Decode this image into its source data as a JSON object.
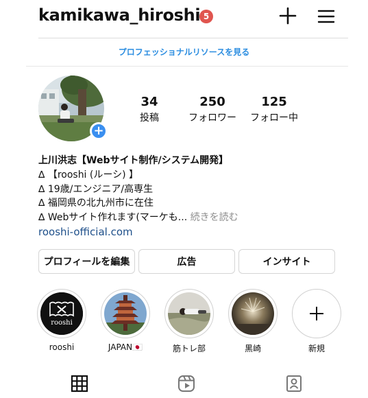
{
  "header": {
    "username": "kamikawa_hiroshi",
    "notification_count": "5",
    "plus_icon": "plus-icon",
    "menu_icon": "hamburger-menu-icon"
  },
  "banner": {
    "pro_resources": "プロフェッショナルリソースを見る"
  },
  "profile": {
    "avatar_add_symbol": "+",
    "stats": [
      {
        "value": "34",
        "label": "投稿"
      },
      {
        "value": "250",
        "label": "フォロワー"
      },
      {
        "value": "125",
        "label": "フォロー中"
      }
    ],
    "bio": {
      "name": "上川洪志【Webサイト制作/システム開発】",
      "line1": "∆ 【rooshi (ルーシ) 】",
      "line2": "∆ 19歳/エンジニア/高専生",
      "line3": "∆ 福岡県の北九州市に在住",
      "line4": "∆ Webサイト作れます(マーケも...",
      "more": "続きを読む",
      "link": "rooshi-official.com"
    }
  },
  "actions": {
    "edit_profile": "プロフィールを編集",
    "ads": "広告",
    "insights": "インサイト"
  },
  "highlights": [
    {
      "label": "rooshi",
      "logo_text": "rooshi"
    },
    {
      "label": "JAPAN🇯🇵"
    },
    {
      "label": "筋トレ部"
    },
    {
      "label": "黒崎"
    },
    {
      "label": "新規",
      "symbol": "+"
    }
  ],
  "tabs": [
    "grid-icon",
    "reels-icon",
    "tagged-icon"
  ],
  "colors": {
    "link_blue": "#2b8de0",
    "badge_red": "#e0554f",
    "add_blue": "#3a8ff0"
  }
}
